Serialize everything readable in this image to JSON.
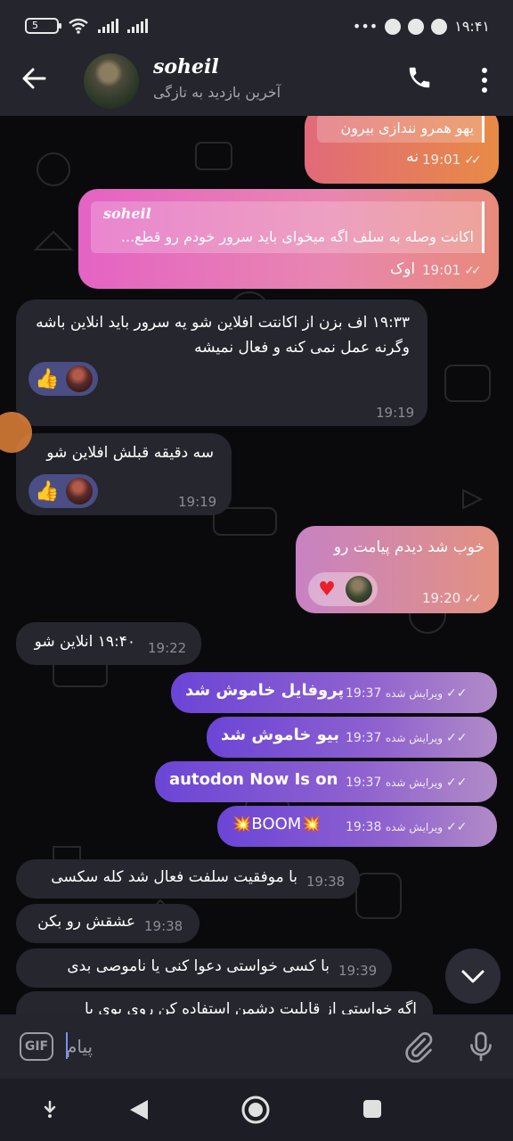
{
  "status_bar": {
    "battery": "5",
    "time": "۱۹:۴۱",
    "more": "•••"
  },
  "header": {
    "contact_name": "soheil",
    "contact_status": "آخرین بازدید به تازگی"
  },
  "messages": [
    {
      "id": 1,
      "side": "out",
      "text_top": "یهو همرو نندازی بیرون",
      "text": "نه",
      "time": "19:01"
    },
    {
      "id": 2,
      "side": "out",
      "reply_name": "soheil",
      "reply_text": "اکانت وصله به سلف اگه میخوای باید سرور خودم رو قطع...",
      "text": "اوک",
      "time": "19:01"
    },
    {
      "id": 3,
      "side": "in",
      "text": "۱۹:۳۳ اف بزن از اکانتت افلاین شو یه سرور باید انلاین باشه وگرنه عمل نمی کنه و فعال نمیشه",
      "reaction": "👍",
      "time": "19:19"
    },
    {
      "id": 4,
      "side": "in",
      "text": "سه دقیقه قبلش افلاین شو",
      "reaction": "👍",
      "time": "19:19"
    },
    {
      "id": 5,
      "side": "out",
      "text": "خوب شد دیدم پیامت رو",
      "reaction": "♥",
      "time": "19:20"
    },
    {
      "id": 6,
      "side": "in",
      "text": "۱۹:۴۰ انلاین شو",
      "time": "19:22"
    },
    {
      "id": 7,
      "side": "out",
      "text": "پروفایل خاموش شد",
      "edited": "ویرایش شده",
      "time": "19:37"
    },
    {
      "id": 8,
      "side": "out",
      "text": "بیو خاموش شد",
      "edited": "ویرایش شده",
      "time": "19:37"
    },
    {
      "id": 9,
      "side": "out",
      "text": "autodon Now Is on",
      "edited": "ویرایش شده",
      "time": "19:37"
    },
    {
      "id": 10,
      "side": "out",
      "text": "💥BOOM💥",
      "edited": "ویرایش شده",
      "time": "19:38"
    },
    {
      "id": 11,
      "side": "in",
      "text": "با موفقیت سلفت فعال شد کله سکسی",
      "time": "19:38"
    },
    {
      "id": 12,
      "side": "in",
      "text": "عشقش رو بکن",
      "time": "19:38"
    },
    {
      "id": 13,
      "side": "in",
      "text": "با کسی خواستی دعوا کنی یا ناموصی بدی",
      "time": "19:39"
    },
    {
      "id": 14,
      "side": "in",
      "text": "اگه خواستی از قابلیت دشمن استفاده کن روی یوی یا"
    }
  ],
  "input": {
    "placeholder": "پیام",
    "gif_label": "GIF"
  },
  "colors": {
    "background": "#0a0a0d",
    "incoming_bubble": "#25262e",
    "outgoing_purple": "#7b55d3",
    "outgoing_orange": "#e8844f",
    "outgoing_pink": "#e463c4"
  }
}
